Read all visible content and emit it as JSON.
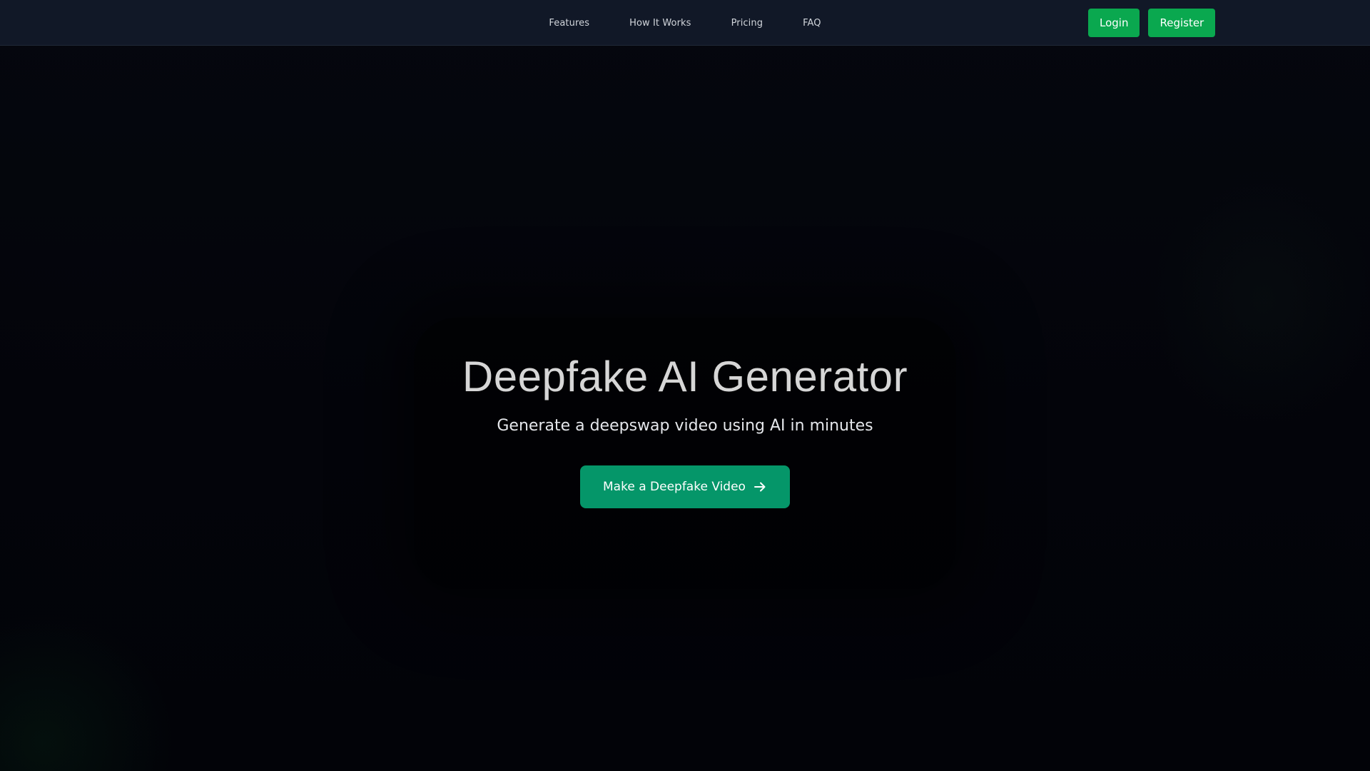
{
  "nav": {
    "links": [
      {
        "label": "Features"
      },
      {
        "label": "How It Works"
      },
      {
        "label": "Pricing"
      },
      {
        "label": "FAQ"
      }
    ],
    "login_label": "Login",
    "register_label": "Register"
  },
  "hero": {
    "title": "Deepfake AI Generator",
    "subtitle": "Generate a deepswap video using AI in minutes",
    "cta_label": "Make a Deepfake Video",
    "cta_icon": "arrow-right-icon"
  },
  "colors": {
    "header_bg": "#111827",
    "page_bg": "#020308",
    "auth_button": "#0aa84f",
    "cta_button": "#059669",
    "text_primary": "#e5e7eb"
  }
}
